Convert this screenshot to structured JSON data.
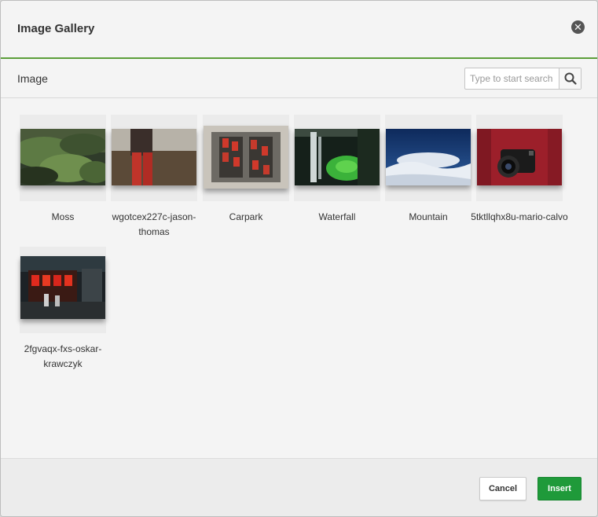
{
  "dialog": {
    "title": "Image Gallery",
    "close_icon": "close-circle-icon"
  },
  "toolbar": {
    "label": "Image",
    "search_placeholder": "Type to start search",
    "search_icon": "search-icon"
  },
  "images": [
    {
      "name": "Moss"
    },
    {
      "name": "wgotcex227c-jason-thomas"
    },
    {
      "name": "Carpark"
    },
    {
      "name": "Waterfall"
    },
    {
      "name": "Mountain"
    },
    {
      "name": "5tktllqhx8u-mario-calvo"
    },
    {
      "name": "2fgvaqx-fxs-oskar-krawczyk"
    }
  ],
  "footer": {
    "cancel_label": "Cancel",
    "insert_label": "Insert"
  },
  "colors": {
    "accent_green": "#5c9e3a",
    "insert_button": "#1f9a3a"
  }
}
